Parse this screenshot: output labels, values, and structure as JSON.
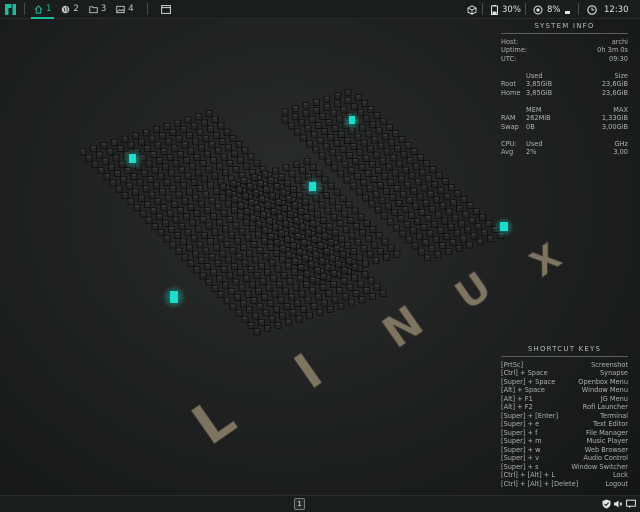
{
  "top_panel": {
    "workspaces": [
      {
        "label": "1",
        "icon": "home-icon",
        "active": true
      },
      {
        "label": "2",
        "icon": "globe-icon",
        "active": false
      },
      {
        "label": "3",
        "icon": "folder-icon",
        "active": false
      },
      {
        "label": "4",
        "icon": "image-icon",
        "active": false
      }
    ],
    "battery": "30%",
    "cpu": "8%",
    "clock": "12:30"
  },
  "system_info": {
    "title": "SYSTEM INFO",
    "host_label": "Host:",
    "host_value": "archi",
    "uptime_label": "Uptime:",
    "uptime_value": "0h 3m 0s",
    "utc_label": "UTC:",
    "utc_value": "09:30",
    "disk_header_used": "Used",
    "disk_header_size": "Size",
    "disk_rows": [
      {
        "name": "Root",
        "used": "3,85GiB",
        "size": "23,6GiB"
      },
      {
        "name": "Home",
        "used": "3,85GiB",
        "size": "23,6GiB"
      }
    ],
    "mem_header_mem": "MEM",
    "mem_header_max": "MAX",
    "mem_rows": [
      {
        "name": "RAM",
        "used": "262MiB",
        "max": "1,33GiB"
      },
      {
        "name": "Swap",
        "used": "0B",
        "max": "3,00GiB"
      }
    ],
    "cpu_header_name": "CPU:",
    "cpu_header_used": "Used",
    "cpu_header_ghz": "GHz",
    "cpu_row": {
      "name": "Avg",
      "used": "2%",
      "ghz": "3,00"
    }
  },
  "shortcut_keys": {
    "title": "SHORTCUT KEYS",
    "items": [
      {
        "key": "[PrtSc]",
        "action": "Screenshot"
      },
      {
        "key": "[Ctrl] + Space",
        "action": "Synapse"
      },
      {
        "key": "[Super] + Space",
        "action": "Openbox Menu"
      },
      {
        "key": "[Alt] + Space",
        "action": "Window Menu"
      },
      {
        "key": "[Alt] + F1",
        "action": "JG Menu"
      },
      {
        "key": "[Alt] + F2",
        "action": "Rofi Launcher"
      },
      {
        "key": "[Super] + [Enter]",
        "action": "Terminal"
      },
      {
        "key": "[Super] + e",
        "action": "Text Editor"
      },
      {
        "key": "[Super] + f",
        "action": "File Manager"
      },
      {
        "key": "[Super] + m",
        "action": "Music Player"
      },
      {
        "key": "[Super] + w",
        "action": "Web Browser"
      },
      {
        "key": "[Super] + v",
        "action": "Audio Control"
      },
      {
        "key": "[Super] + s",
        "action": "Window Switcher"
      },
      {
        "key": "[Ctrl] + [Alt] + L",
        "action": "Lock"
      },
      {
        "key": "[Ctrl] + [Alt] + [Delete]",
        "action": "Logout"
      }
    ]
  },
  "wallpaper": {
    "letters": [
      "L",
      "I",
      "N",
      "U",
      "X"
    ],
    "accent": "#1de9d6"
  },
  "bottom_panel": {
    "desktop_number": "1"
  },
  "colors": {
    "accent": "#1abc9c",
    "panel": "#1b1c1c",
    "block": "#262727"
  }
}
